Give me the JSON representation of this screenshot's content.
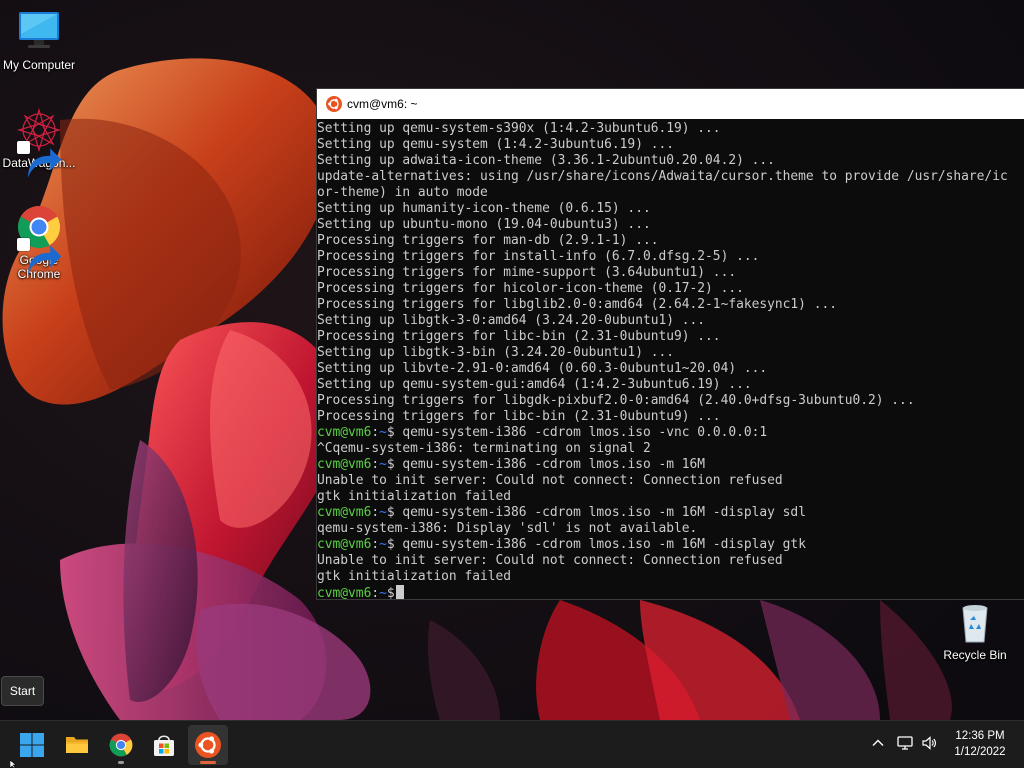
{
  "desktop": {
    "icons": [
      {
        "label": "My Computer",
        "icon": "monitor-icon"
      },
      {
        "label": "DataWagon...",
        "icon": "datawagon-icon",
        "shortcut": true
      },
      {
        "label": "Google Chrome",
        "icon": "chrome-icon",
        "shortcut": true
      },
      {
        "label": "Recycle Bin",
        "icon": "recycle-bin-icon"
      }
    ]
  },
  "terminal": {
    "title": "cvm@vm6: ~",
    "prompt": {
      "user": "cvm@vm6",
      "sep": ":",
      "dir": "~",
      "symbol": "$"
    },
    "lines": [
      {
        "text": "Setting up qemu-system-s390x (1:4.2-3ubuntu6.19) ..."
      },
      {
        "text": "Setting up qemu-system (1:4.2-3ubuntu6.19) ..."
      },
      {
        "text": "Setting up adwaita-icon-theme (3.36.1-2ubuntu0.20.04.2) ..."
      },
      {
        "text": "update-alternatives: using /usr/share/icons/Adwaita/cursor.theme to provide /usr/share/ic"
      },
      {
        "text": "or-theme) in auto mode"
      },
      {
        "text": "Setting up humanity-icon-theme (0.6.15) ..."
      },
      {
        "text": "Setting up ubuntu-mono (19.04-0ubuntu3) ..."
      },
      {
        "text": "Processing triggers for man-db (2.9.1-1) ..."
      },
      {
        "text": "Processing triggers for install-info (6.7.0.dfsg.2-5) ..."
      },
      {
        "text": "Processing triggers for mime-support (3.64ubuntu1) ..."
      },
      {
        "text": "Processing triggers for hicolor-icon-theme (0.17-2) ..."
      },
      {
        "text": "Processing triggers for libglib2.0-0:amd64 (2.64.2-1~fakesync1) ..."
      },
      {
        "text": "Setting up libgtk-3-0:amd64 (3.24.20-0ubuntu1) ..."
      },
      {
        "text": "Processing triggers for libc-bin (2.31-0ubuntu9) ..."
      },
      {
        "text": "Setting up libgtk-3-bin (3.24.20-0ubuntu1) ..."
      },
      {
        "text": "Setting up libvte-2.91-0:amd64 (0.60.3-0ubuntu1~20.04) ..."
      },
      {
        "text": "Setting up qemu-system-gui:amd64 (1:4.2-3ubuntu6.19) ..."
      },
      {
        "text": "Processing triggers for libgdk-pixbuf2.0-0:amd64 (2.40.0+dfsg-3ubuntu0.2) ..."
      },
      {
        "text": "Processing triggers for libc-bin (2.31-0ubuntu9) ..."
      },
      {
        "prompt": true,
        "text": " qemu-system-i386 -cdrom lmos.iso -vnc 0.0.0.0:1"
      },
      {
        "text": "^Cqemu-system-i386: terminating on signal 2"
      },
      {
        "prompt": true,
        "text": " qemu-system-i386 -cdrom lmos.iso -m 16M"
      },
      {
        "text": "Unable to init server: Could not connect: Connection refused"
      },
      {
        "text": "gtk initialization failed"
      },
      {
        "prompt": true,
        "text": " qemu-system-i386 -cdrom lmos.iso -m 16M -display sdl"
      },
      {
        "text": "qemu-system-i386: Display 'sdl' is not available."
      },
      {
        "prompt": true,
        "text": " qemu-system-i386 -cdrom lmos.iso -m 16M -display gtk"
      },
      {
        "text": "Unable to init server: Could not connect: Connection refused"
      },
      {
        "text": "gtk initialization failed"
      },
      {
        "prompt": true,
        "text": "",
        "cursor": true
      }
    ]
  },
  "start_tooltip": "Start",
  "taskbar": {
    "apps": [
      {
        "name": "start",
        "icon": "windows-start-icon"
      },
      {
        "name": "file-explorer",
        "icon": "folder-icon"
      },
      {
        "name": "chrome",
        "icon": "chrome-icon",
        "running": true
      },
      {
        "name": "microsoft-store",
        "icon": "store-icon"
      },
      {
        "name": "terminal",
        "icon": "ubuntu-icon",
        "running": true,
        "active": true
      }
    ],
    "tray": [
      "chevron-up-icon",
      "network-icon",
      "volume-icon"
    ],
    "clock": {
      "time": "12:36 PM",
      "date": "1/12/2022"
    }
  },
  "colors": {
    "prompt_user": "#5bd044",
    "prompt_dir": "#3b78ff",
    "terminal_text": "#cccccc",
    "terminal_bg": "#0c0c0c",
    "taskbar_bg": "#1c1c1c",
    "ubuntu_orange": "#e95420"
  }
}
